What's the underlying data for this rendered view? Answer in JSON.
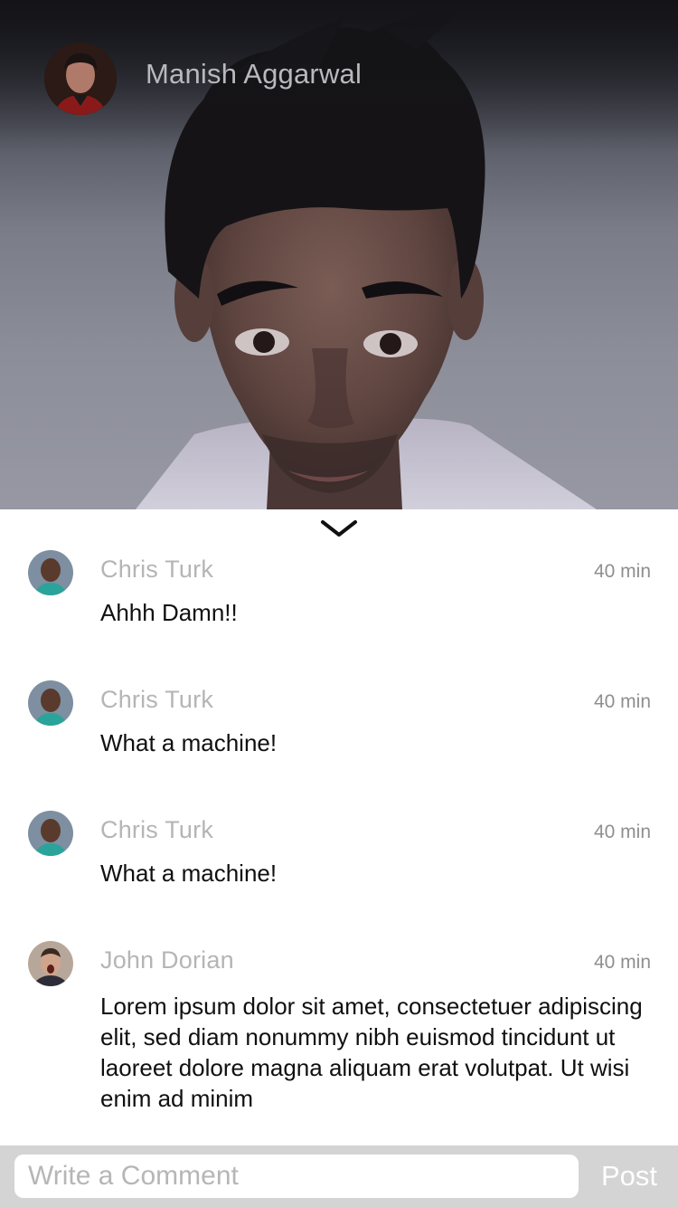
{
  "post": {
    "author_name": "Manish Aggarwal"
  },
  "comments": [
    {
      "author": "Chris Turk",
      "time": "40 min",
      "text": "Ahhh Damn!!"
    },
    {
      "author": "Chris Turk",
      "time": "40 min",
      "text": "What a machine!"
    },
    {
      "author": "Chris Turk",
      "time": "40 min",
      "text": "What a machine!"
    },
    {
      "author": "John Dorian",
      "time": "40 min",
      "text": "Lorem ipsum dolor sit amet, consectetuer adipiscing elit, sed diam nonummy nibh euismod tincidunt ut laoreet dolore magna aliquam erat volutpat. Ut wisi enim ad minim"
    }
  ],
  "composer": {
    "placeholder": "Write a Comment",
    "post_label": "Post"
  },
  "icons": {
    "collapse": "chevron-down-icon"
  },
  "colors": {
    "author_gray": "#b5b5b5",
    "time_gray": "#8f8f8f",
    "composer_bar": "#d4d4d4",
    "post_text": "#ffffff"
  }
}
